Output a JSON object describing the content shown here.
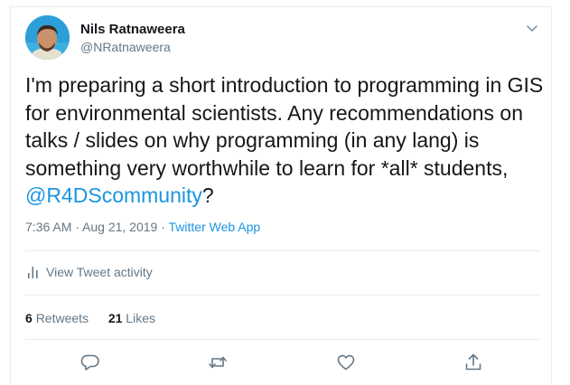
{
  "tweet": {
    "author_name": "Nils Ratnaweera",
    "author_handle": "@NRatnaweera",
    "text_before_mention": "I'm preparing a short introduction to programming in GIS for environmental scientists. Any recommendations on talks / slides on why programming (in any lang) is something very worthwhile to learn for *all* students, ",
    "mention": "@R4DScommunity",
    "text_after_mention": "?",
    "timestamp": "7:36 AM · Aug 21, 2019 · ",
    "source": "Twitter Web App",
    "activity_label": "View Tweet activity",
    "retweets_count": "6",
    "retweets_label": "Retweets",
    "likes_count": "21",
    "likes_label": "Likes"
  },
  "icons": {
    "menu": "chevron-down-icon",
    "activity": "bar-chart-icon",
    "reply": "reply-icon",
    "retweet": "retweet-icon",
    "like": "heart-icon",
    "share": "share-icon"
  },
  "colors": {
    "link": "#1b95e0",
    "muted": "#657786",
    "text": "#14171a",
    "border": "#e6ecf0"
  }
}
